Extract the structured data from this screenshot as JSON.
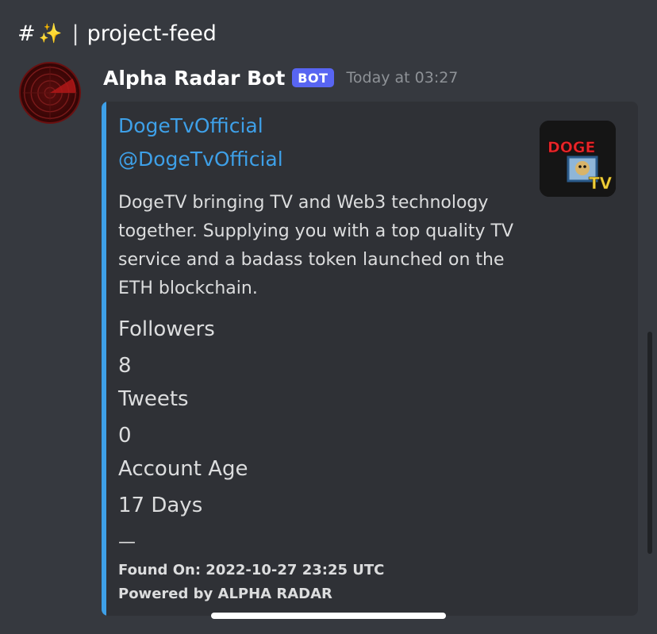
{
  "channel": {
    "hash": "#",
    "emoji": "✨",
    "separator": "|",
    "name": "project-feed"
  },
  "message": {
    "author": "Alpha Radar Bot",
    "badge": "BOT",
    "timestamp": "Today at 03:27"
  },
  "embed": {
    "accent_color": "#3ea0e8",
    "author_name": "DogeTvOfficial",
    "author_handle": "@DogeTvOfficial",
    "thumbnail_text_1": "DOGE",
    "thumbnail_text_2": "TV",
    "description": "DogeTV bringing TV and Web3 technology together. Supplying you with a top quality TV service and a badass token launched on the ETH blockchain.",
    "fields": [
      {
        "name": "Followers",
        "value": "8"
      },
      {
        "name": "Tweets",
        "value": "0"
      },
      {
        "name": "Account Age",
        "value": "17 Days"
      }
    ],
    "divider": "—",
    "footer_found": "Found On: 2022-10-27 23:25 UTC",
    "footer_powered": "Powered by ALPHA RADAR"
  },
  "colors": {
    "background": "#36393f",
    "embed_background": "#2f3136",
    "link": "#3ea0e8",
    "bot_badge": "#5865f2"
  }
}
